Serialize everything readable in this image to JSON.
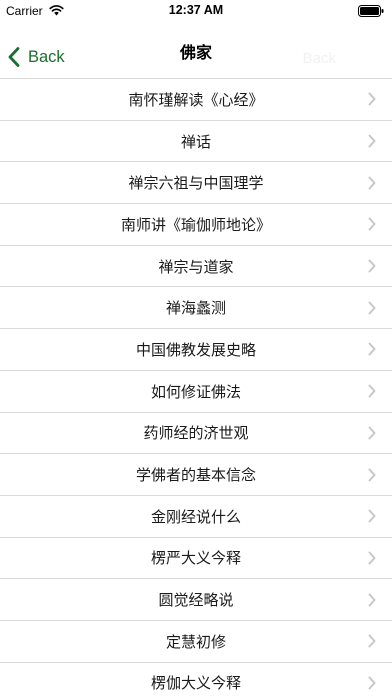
{
  "status_bar": {
    "carrier": "Carrier",
    "time": "12:37 AM",
    "wifi_icon": "wifi-icon",
    "battery_icon": "battery-icon"
  },
  "nav": {
    "back_label": "Back",
    "title": "佛家",
    "ghost_label": "Back",
    "accent_color": "#1b6e2c"
  },
  "list": {
    "chevron_icon": "chevron-right-icon",
    "items": [
      {
        "label": "南怀瑾解读《心经》"
      },
      {
        "label": "禅话"
      },
      {
        "label": "禅宗六祖与中国理学"
      },
      {
        "label": "南师讲《瑜伽师地论》"
      },
      {
        "label": "禅宗与道家"
      },
      {
        "label": "禅海蠡测"
      },
      {
        "label": "中国佛教发展史略"
      },
      {
        "label": "如何修证佛法"
      },
      {
        "label": "药师经的济世观"
      },
      {
        "label": "学佛者的基本信念"
      },
      {
        "label": "金刚经说什么"
      },
      {
        "label": "楞严大义今释"
      },
      {
        "label": "圆觉经略说"
      },
      {
        "label": "定慧初修"
      },
      {
        "label": "楞伽大义今释"
      }
    ]
  }
}
